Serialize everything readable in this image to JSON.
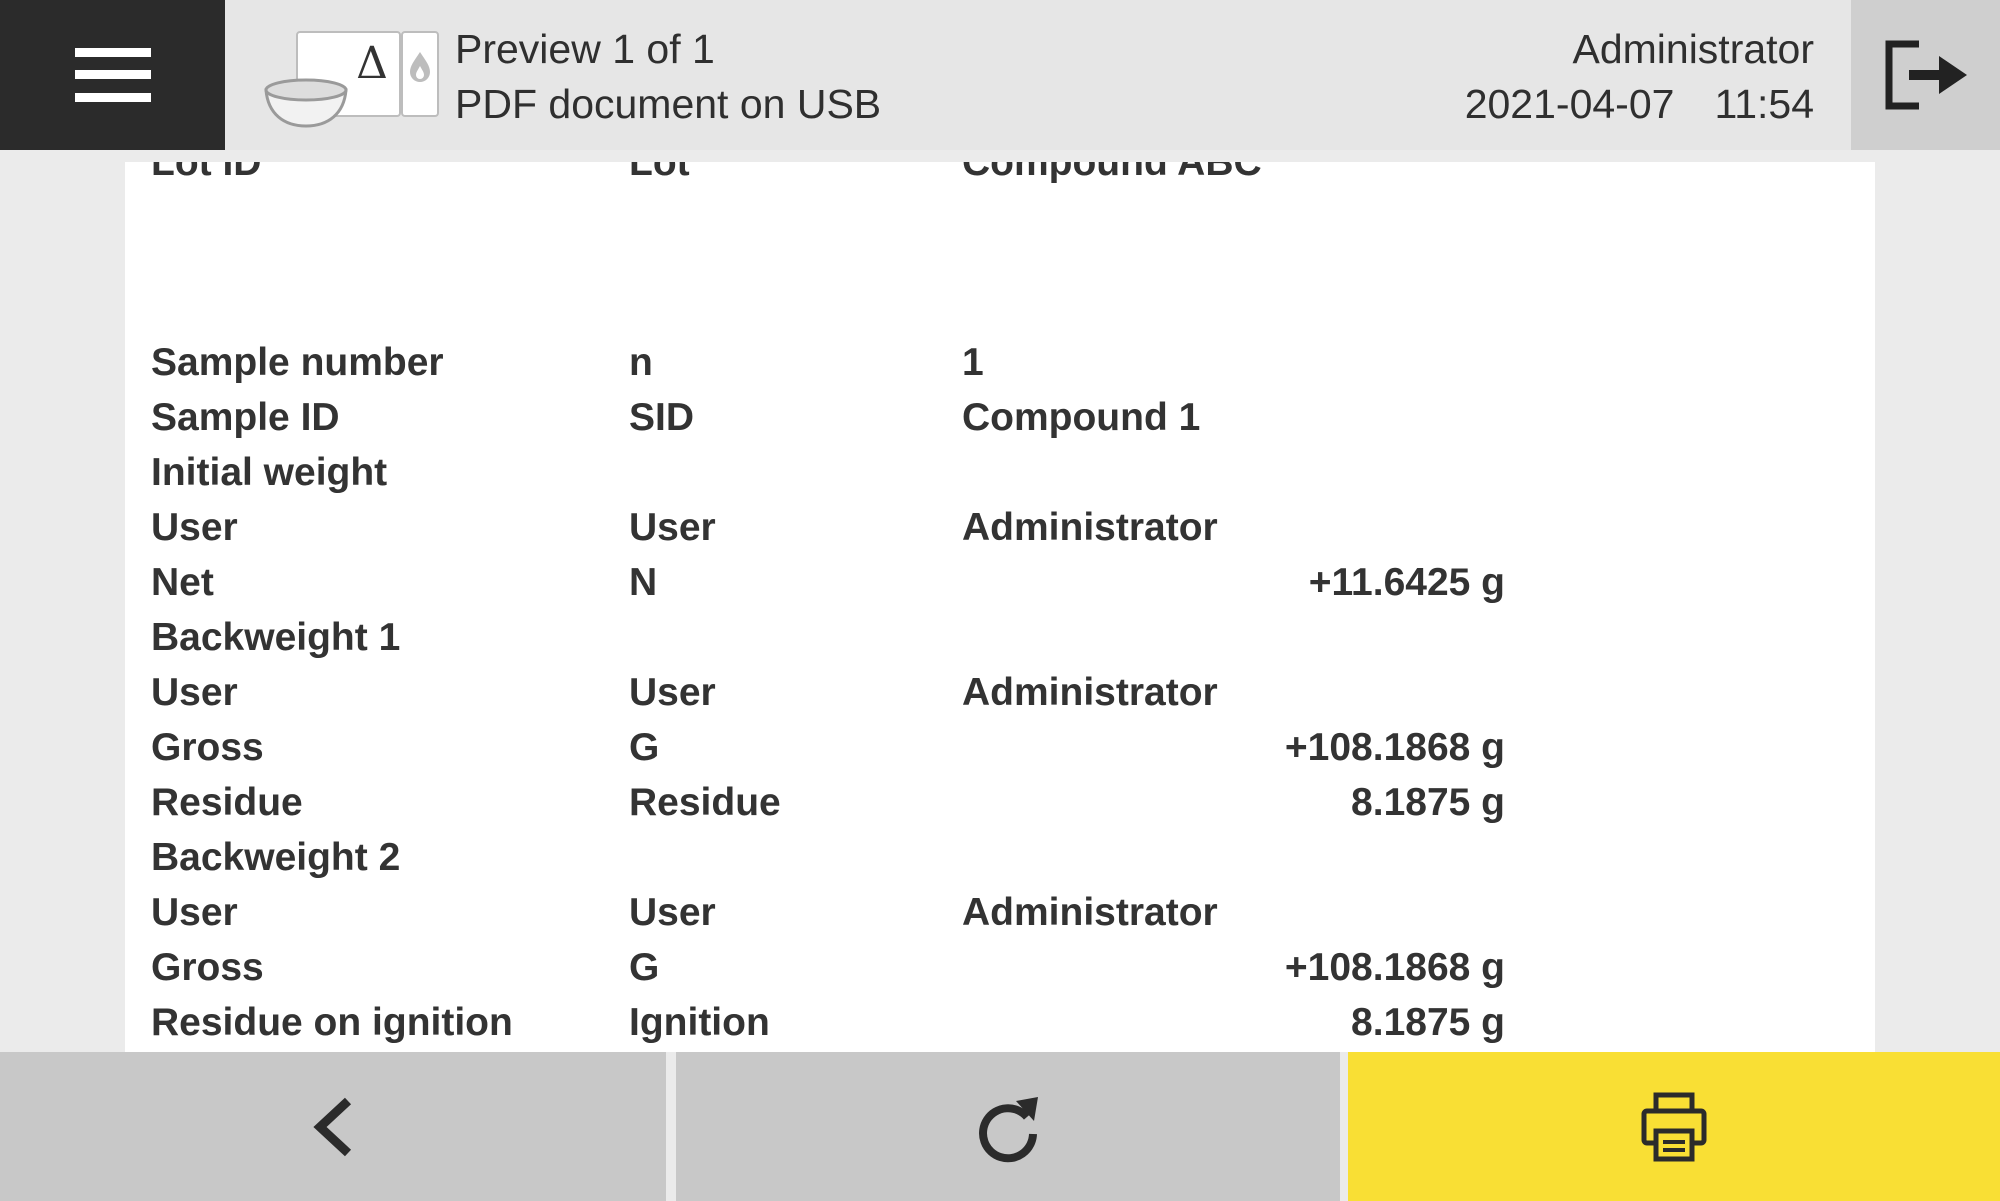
{
  "header": {
    "menu_icon": "hamburger-menu-icon",
    "app_icon": "weighing-delta-ignition-icon",
    "title": "Preview 1 of 1",
    "subtitle": "PDF document on USB",
    "user": "Administrator",
    "date": "2021-04-07",
    "time": "11:54",
    "logout_icon": "logout-icon"
  },
  "document": {
    "rows": [
      {
        "label": "Lot ID",
        "symbol": "Lot",
        "value": "Compound ABC",
        "amount": ""
      },
      {
        "label": "Sample number",
        "symbol": "n",
        "value": "1",
        "amount": ""
      },
      {
        "label": "Sample ID",
        "symbol": "SID",
        "value": "Compound 1",
        "amount": ""
      },
      {
        "label": "Initial weight",
        "symbol": "",
        "value": "",
        "amount": ""
      },
      {
        "label": "User",
        "symbol": "User",
        "value": "Administrator",
        "amount": ""
      },
      {
        "label": "Net",
        "symbol": "N",
        "value": "",
        "amount": "+11.6425 g"
      },
      {
        "label": "Backweight 1",
        "symbol": "",
        "value": "",
        "amount": ""
      },
      {
        "label": "User",
        "symbol": "User",
        "value": "Administrator",
        "amount": ""
      },
      {
        "label": "Gross",
        "symbol": "G",
        "value": "",
        "amount": "+108.1868 g"
      },
      {
        "label": "Residue",
        "symbol": "Residue",
        "value": "",
        "amount": "8.1875 g"
      },
      {
        "label": "Backweight 2",
        "symbol": "",
        "value": "",
        "amount": ""
      },
      {
        "label": "User",
        "symbol": "User",
        "value": "Administrator",
        "amount": ""
      },
      {
        "label": "Gross",
        "symbol": "G",
        "value": "",
        "amount": "+108.1868 g"
      },
      {
        "label": "Residue on ignition",
        "symbol": "Ignition",
        "value": "",
        "amount": "8.1875 g"
      }
    ]
  },
  "footer": {
    "back_icon": "chevron-left-icon",
    "reload_icon": "refresh-icon",
    "print_icon": "printer-icon",
    "print_color": "#f9df34"
  }
}
